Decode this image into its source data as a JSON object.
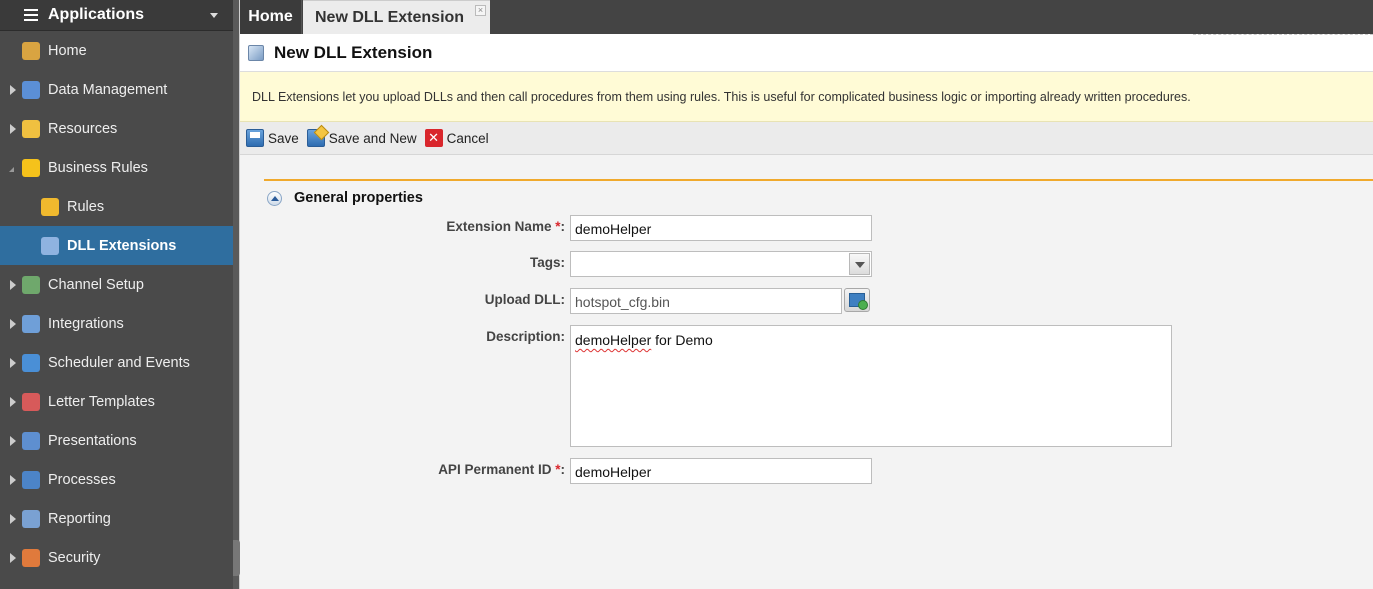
{
  "sidebar": {
    "header": "Applications",
    "items": [
      {
        "label": "Home",
        "icon": "home-icon",
        "expandable": false,
        "child": false
      },
      {
        "label": "Data Management",
        "icon": "data-management-icon",
        "expandable": true,
        "child": false
      },
      {
        "label": "Resources",
        "icon": "resources-icon",
        "expandable": true,
        "child": false
      },
      {
        "label": "Business Rules",
        "icon": "lightning-icon",
        "expandable": true,
        "open": true,
        "child": false
      },
      {
        "label": "Rules",
        "icon": "rules-icon",
        "expandable": false,
        "child": true
      },
      {
        "label": "DLL Extensions",
        "icon": "dll-extension-icon",
        "expandable": false,
        "child": true,
        "active": true
      },
      {
        "label": "Channel Setup",
        "icon": "channel-setup-icon",
        "expandable": true,
        "child": false
      },
      {
        "label": "Integrations",
        "icon": "integrations-icon",
        "expandable": true,
        "child": false
      },
      {
        "label": "Scheduler and Events",
        "icon": "scheduler-icon",
        "expandable": true,
        "child": false
      },
      {
        "label": "Letter Templates",
        "icon": "letter-templates-icon",
        "expandable": true,
        "child": false
      },
      {
        "label": "Presentations",
        "icon": "presentations-icon",
        "expandable": true,
        "child": false
      },
      {
        "label": "Processes",
        "icon": "processes-icon",
        "expandable": true,
        "child": false
      },
      {
        "label": "Reporting",
        "icon": "reporting-icon",
        "expandable": true,
        "child": false
      },
      {
        "label": "Security",
        "icon": "security-icon",
        "expandable": true,
        "child": false
      }
    ]
  },
  "tabs": {
    "home": "Home",
    "active": "New DLL Extension",
    "close_glyph": "×"
  },
  "page": {
    "title": "New DLL Extension",
    "info": "DLL Extensions let you upload DLLs and then call procedures from them using rules. This is useful for complicated business logic or importing already written procedures."
  },
  "toolbar": {
    "save": "Save",
    "save_and_new": "Save and New",
    "cancel": "Cancel",
    "cancel_glyph": "✕"
  },
  "form": {
    "section_title": "General properties",
    "required_mark": "*",
    "extension_name": {
      "label": "Extension Name",
      "value": "demoHelper"
    },
    "tags": {
      "label": "Tags:",
      "value": ""
    },
    "upload_dll": {
      "label": "Upload DLL:",
      "value": "hotspot_cfg.bin"
    },
    "description": {
      "label": "Description:",
      "value_underlined": "demoHelper",
      "value_rest": " for Demo"
    },
    "api_permanent_id": {
      "label": "API Permanent ID",
      "value": "demoHelper"
    }
  },
  "colors": {
    "sidebar_bg": "#4a4a4a",
    "sidebar_active": "#2f6e9f",
    "section_accent": "#f0a92c",
    "info_bg": "#fffbd6",
    "required": "#d9262c"
  }
}
